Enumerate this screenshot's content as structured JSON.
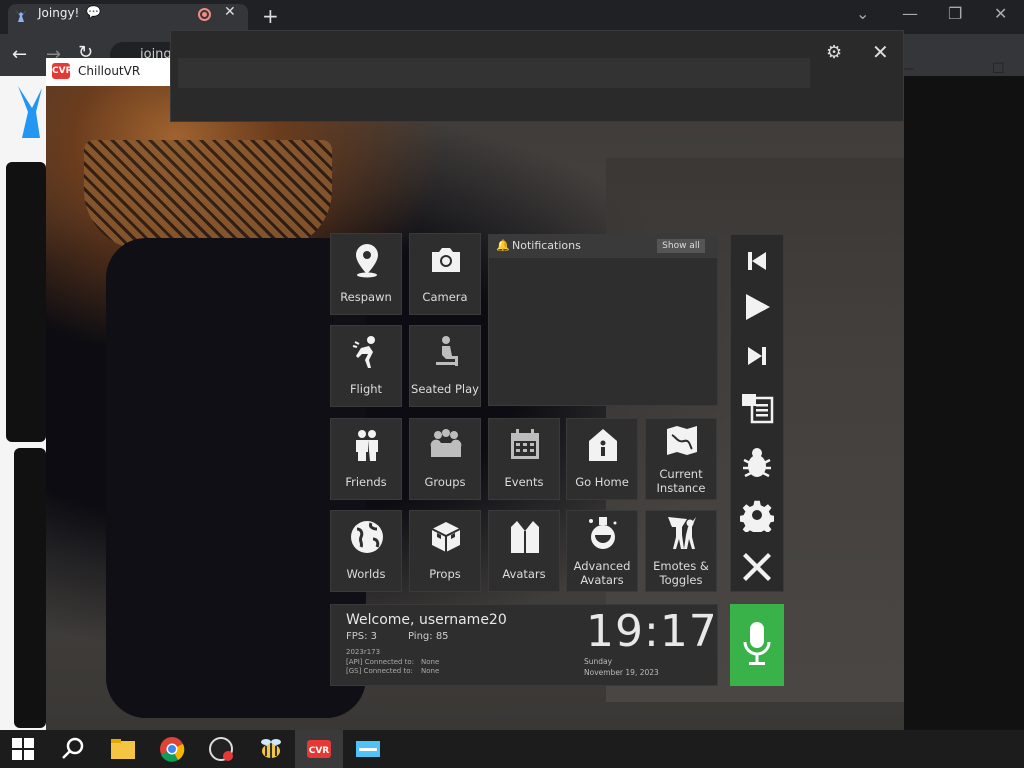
{
  "browser": {
    "tab_title": "Joingy!",
    "tab_chat_icon": "chat-bubble-icon",
    "url_text": "joingy.com"
  },
  "game_window": {
    "title": "ChilloutVR",
    "logo_text": "CVR"
  },
  "quick_menu": {
    "tiles": [
      {
        "label": "Respawn",
        "icon": "location-pin-icon"
      },
      {
        "label": "Camera",
        "icon": "camera-icon"
      },
      {
        "label": "Flight",
        "icon": "flight-icon"
      },
      {
        "label": "Seated Play",
        "icon": "seated-icon"
      },
      {
        "label": "Friends",
        "icon": "friends-icon"
      },
      {
        "label": "Groups",
        "icon": "groups-icon"
      },
      {
        "label": "Events",
        "icon": "calendar-icon"
      },
      {
        "label": "Go Home",
        "icon": "home-icon"
      },
      {
        "label": "Current Instance",
        "icon": "map-icon"
      },
      {
        "label": "Worlds",
        "icon": "globe-icon"
      },
      {
        "label": "Props",
        "icon": "cube-icon"
      },
      {
        "label": "Avatars",
        "icon": "avatar-icon"
      },
      {
        "label": "Advanced Avatars",
        "icon": "potion-icon"
      },
      {
        "label": "Emotes & Toggles",
        "icon": "emotes-icon"
      }
    ],
    "notifications": {
      "title": "Notifications",
      "show_all": "Show all"
    },
    "side_buttons": [
      "previous-track-icon",
      "play-icon",
      "next-track-icon",
      "console-log-icon",
      "bug-icon",
      "gear-icon",
      "close-icon"
    ],
    "status": {
      "welcome": "Welcome, username20",
      "fps_label": "FPS:  3",
      "ping_label": "Ping:  85",
      "build": "2023r173",
      "api_label": "[API] Connected to:",
      "api_value": "None",
      "gs_label": "[GS] Connected to:",
      "gs_value": "None",
      "time": "19:17",
      "day": "Sunday",
      "date": "November 19, 2023"
    },
    "mic_state": "unmuted"
  },
  "colors": {
    "mic_green": "#38b249",
    "tile_bg": "#2e2e2e",
    "cvr_red": "#e53935"
  }
}
